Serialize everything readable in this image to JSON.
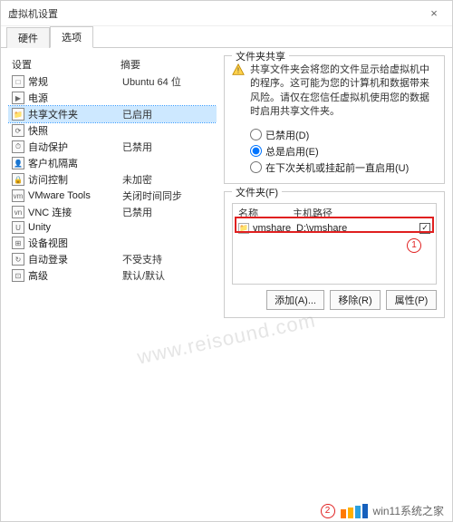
{
  "window": {
    "title": "虚拟机设置",
    "close_glyph": "×"
  },
  "tabs": {
    "hardware": "硬件",
    "options": "选项"
  },
  "left": {
    "col_device": "设置",
    "col_summary": "摘要",
    "rows": [
      {
        "icon": "□",
        "name": "常规",
        "summary": "Ubuntu 64 位"
      },
      {
        "icon": "▶",
        "name": "电源",
        "summary": ""
      },
      {
        "icon": "📁",
        "name": "共享文件夹",
        "summary": "已启用",
        "selected": true
      },
      {
        "icon": "⟳",
        "name": "快照",
        "summary": ""
      },
      {
        "icon": "⏱",
        "name": "自动保护",
        "summary": "已禁用"
      },
      {
        "icon": "👤",
        "name": "客户机隔离",
        "summary": ""
      },
      {
        "icon": "🔒",
        "name": "访问控制",
        "summary": "未加密"
      },
      {
        "icon": "vm",
        "name": "VMware Tools",
        "summary": "关闭时间同步"
      },
      {
        "icon": "vn",
        "name": "VNC 连接",
        "summary": "已禁用"
      },
      {
        "icon": "U",
        "name": "Unity",
        "summary": ""
      },
      {
        "icon": "⊞",
        "name": "设备视图",
        "summary": ""
      },
      {
        "icon": "↻",
        "name": "自动登录",
        "summary": "不受支持"
      },
      {
        "icon": "⊡",
        "name": "高级",
        "summary": "默认/默认"
      }
    ]
  },
  "share": {
    "group_title": "文件夹共享",
    "warning": "共享文件夹会将您的文件显示给虚拟机中的程序。这可能为您的计算机和数据带来风险。请仅在您信任虚拟机使用您的数据时启用共享文件夹。",
    "radio_disabled": "已禁用(D)",
    "radio_always": "总是启用(E)",
    "radio_until": "在下次关机或挂起前一直启用(U)",
    "selected_radio": "always"
  },
  "folders": {
    "group_title": "文件夹(F)",
    "col_name": "名称",
    "col_path": "主机路径",
    "rows": [
      {
        "name": "vmshare",
        "path": "D:\\vmshare",
        "checked": true
      }
    ],
    "btn_add": "添加(A)...",
    "btn_remove": "移除(R)",
    "btn_props": "属性(P)"
  },
  "annotations": {
    "circle1": "1",
    "circle2": "2"
  },
  "footer": {
    "text": "win11系统之家",
    "logo_colors": [
      "#ff7a00",
      "#ffb000",
      "#2aa0e0",
      "#1560bd"
    ]
  },
  "watermark": "www.reisound.com"
}
